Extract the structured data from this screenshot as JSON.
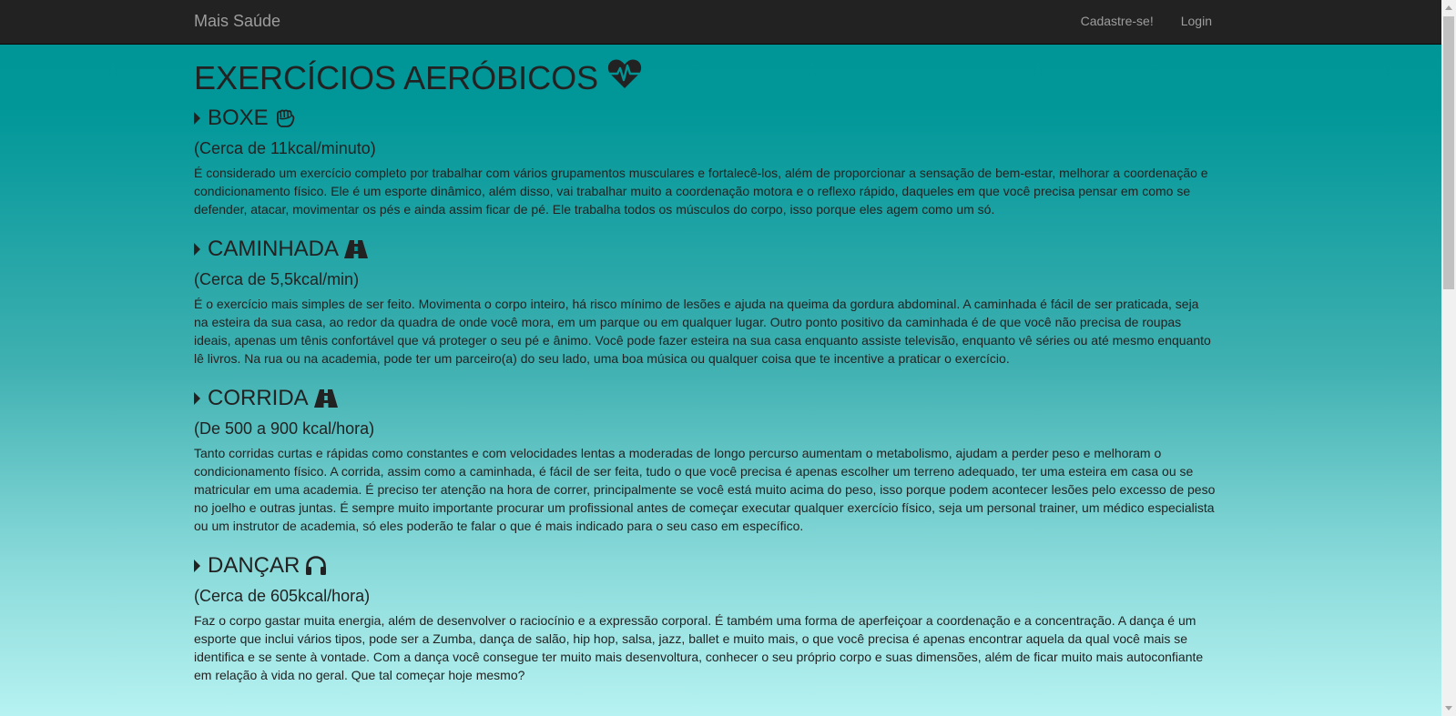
{
  "navbar": {
    "brand": "Mais Saúde",
    "links": [
      "Cadastre-se!",
      "Login"
    ]
  },
  "page": {
    "title": "EXERCÍCIOS AERÓBICOS",
    "title_icon": "heartbeat-icon"
  },
  "sections": [
    {
      "title": "BOXE",
      "icon": "fist-icon",
      "rate": "(Cerca de 11kcal/minuto)",
      "text": "É considerado um exercício completo por trabalhar com vários grupamentos musculares e fortalecê-los, além de proporcionar a sensação de bem-estar, melhorar a coordenação e condicionamento físico. Ele é um esporte dinâmico, além disso, vai trabalhar muito a coordenação motora e o reflexo rápido, daqueles em que você precisa pensar em como se defender, atacar, movimentar os pés e ainda assim ficar de pé. Ele trabalha todos os músculos do corpo, isso porque eles agem como um só."
    },
    {
      "title": "CAMINHADA",
      "icon": "road-icon",
      "rate": "(Cerca de 5,5kcal/min)",
      "text": "É o exercício mais simples de ser feito. Movimenta o corpo inteiro, há risco mínimo de lesões e ajuda na queima da gordura abdominal. A caminhada é fácil de ser praticada, seja na esteira da sua casa, ao redor da quadra de onde você mora, em um parque ou em qualquer lugar. Outro ponto positivo da caminhada é de que você não precisa de roupas ideais, apenas um tênis confortável que vá proteger o seu pé e ânimo. Você pode fazer esteira na sua casa enquanto assiste televisão, enquanto vê séries ou até mesmo enquanto lê livros. Na rua ou na academia, pode ter um parceiro(a) do seu lado, uma boa música ou qualquer coisa que te incentive a praticar o exercício."
    },
    {
      "title": "CORRIDA",
      "icon": "road-icon",
      "rate": "(De 500 a 900 kcal/hora)",
      "text": "Tanto corridas curtas e rápidas como constantes e com velocidades lentas a moderadas de longo percurso aumentam o metabolismo, ajudam a perder peso e melhoram o condicionamento físico. A corrida, assim como a caminhada, é fácil de ser feita, tudo o que você precisa é apenas escolher um terreno adequado, ter uma esteira em casa ou se matricular em uma academia. É preciso ter atenção na hora de correr, principalmente se você está muito acima do peso, isso porque podem acontecer lesões pelo excesso de peso no joelho e outras juntas. É sempre muito importante procurar um profissional antes de começar executar qualquer exercício físico, seja um personal trainer, um médico especialista ou um instrutor de academia, só eles poderão te falar o que é mais indicado para o seu caso em específico."
    },
    {
      "title": "DANÇAR",
      "icon": "headphones-icon",
      "rate": "(Cerca de 605kcal/hora)",
      "text": "Faz o corpo gastar muita energia, além de desenvolver o raciocínio e a expressão corporal. É também uma forma de aperfeiçoar a coordenação e a concentração. A dança é um esporte que inclui vários tipos, pode ser a Zumba, dança de salão, hip hop, salsa, jazz, ballet e muito mais, o que você precisa é apenas encontrar aquela da qual você mais se identifica e se sente à vontade. Com a dança você consegue ter muito mais desenvoltura, conhecer o seu próprio corpo e suas dimensões, além de ficar muito mais autoconfiante em relação à vida no geral. Que tal começar hoje mesmo?"
    }
  ]
}
